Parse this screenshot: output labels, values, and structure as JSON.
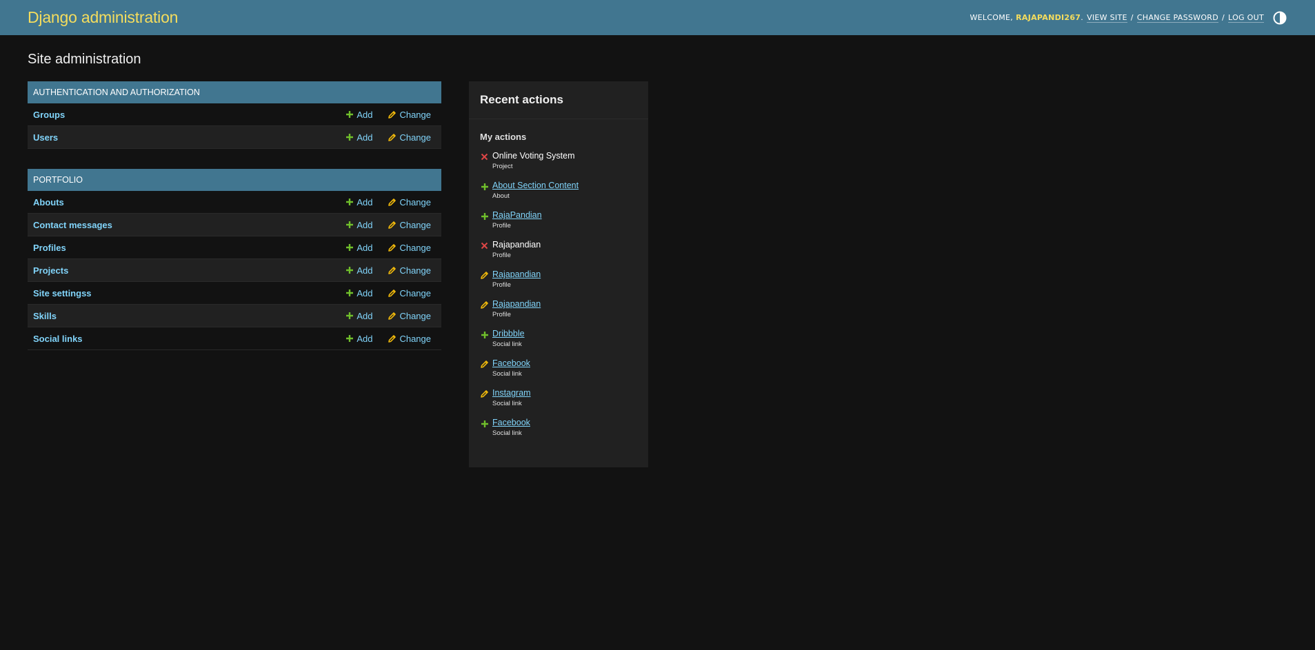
{
  "header": {
    "site_name": "Django administration",
    "welcome": "WELCOME,",
    "username": "RAJAPANDI267",
    "username_suffix": ".",
    "view_site": "VIEW SITE",
    "change_password": "CHANGE PASSWORD",
    "log_out": "LOG OUT",
    "separator": "/"
  },
  "page": {
    "title": "Site administration"
  },
  "modules": [
    {
      "caption": "AUTHENTICATION AND AUTHORIZATION",
      "models": [
        {
          "name": "Groups",
          "add": "Add",
          "change": "Change"
        },
        {
          "name": "Users",
          "add": "Add",
          "change": "Change"
        }
      ]
    },
    {
      "caption": "PORTFOLIO",
      "models": [
        {
          "name": "Abouts",
          "add": "Add",
          "change": "Change"
        },
        {
          "name": "Contact messages",
          "add": "Add",
          "change": "Change"
        },
        {
          "name": "Profiles",
          "add": "Add",
          "change": "Change"
        },
        {
          "name": "Projects",
          "add": "Add",
          "change": "Change"
        },
        {
          "name": "Site settingss",
          "add": "Add",
          "change": "Change"
        },
        {
          "name": "Skills",
          "add": "Add",
          "change": "Change"
        },
        {
          "name": "Social links",
          "add": "Add",
          "change": "Change"
        }
      ]
    }
  ],
  "recent_actions": {
    "title": "Recent actions",
    "subtitle": "My actions",
    "items": [
      {
        "icon": "delete-icon",
        "title": "Online Voting System",
        "type": "Project",
        "link": false
      },
      {
        "icon": "add-icon",
        "title": "About Section Content",
        "type": "About",
        "link": true
      },
      {
        "icon": "add-icon",
        "title": "RajaPandian",
        "type": "Profile",
        "link": true
      },
      {
        "icon": "delete-icon",
        "title": "Rajapandian",
        "type": "Profile",
        "link": false
      },
      {
        "icon": "change-icon",
        "title": "Rajapandian",
        "type": "Profile",
        "link": true
      },
      {
        "icon": "change-icon",
        "title": "Rajapandian",
        "type": "Profile",
        "link": true
      },
      {
        "icon": "add-icon",
        "title": "Dribbble",
        "type": "Social link",
        "link": true
      },
      {
        "icon": "change-icon",
        "title": "Facebook",
        "type": "Social link",
        "link": true
      },
      {
        "icon": "change-icon",
        "title": "Instagram",
        "type": "Social link",
        "link": true
      },
      {
        "icon": "add-icon",
        "title": "Facebook",
        "type": "Social link",
        "link": true
      }
    ]
  },
  "colors": {
    "header_bg": "#417690",
    "brand_yellow": "#f5dd5d",
    "link": "#81d4fa",
    "add_green": "#70bf2b",
    "change_yellow": "#efb80b",
    "delete_red": "#dd4646",
    "page_bg": "#121212"
  }
}
